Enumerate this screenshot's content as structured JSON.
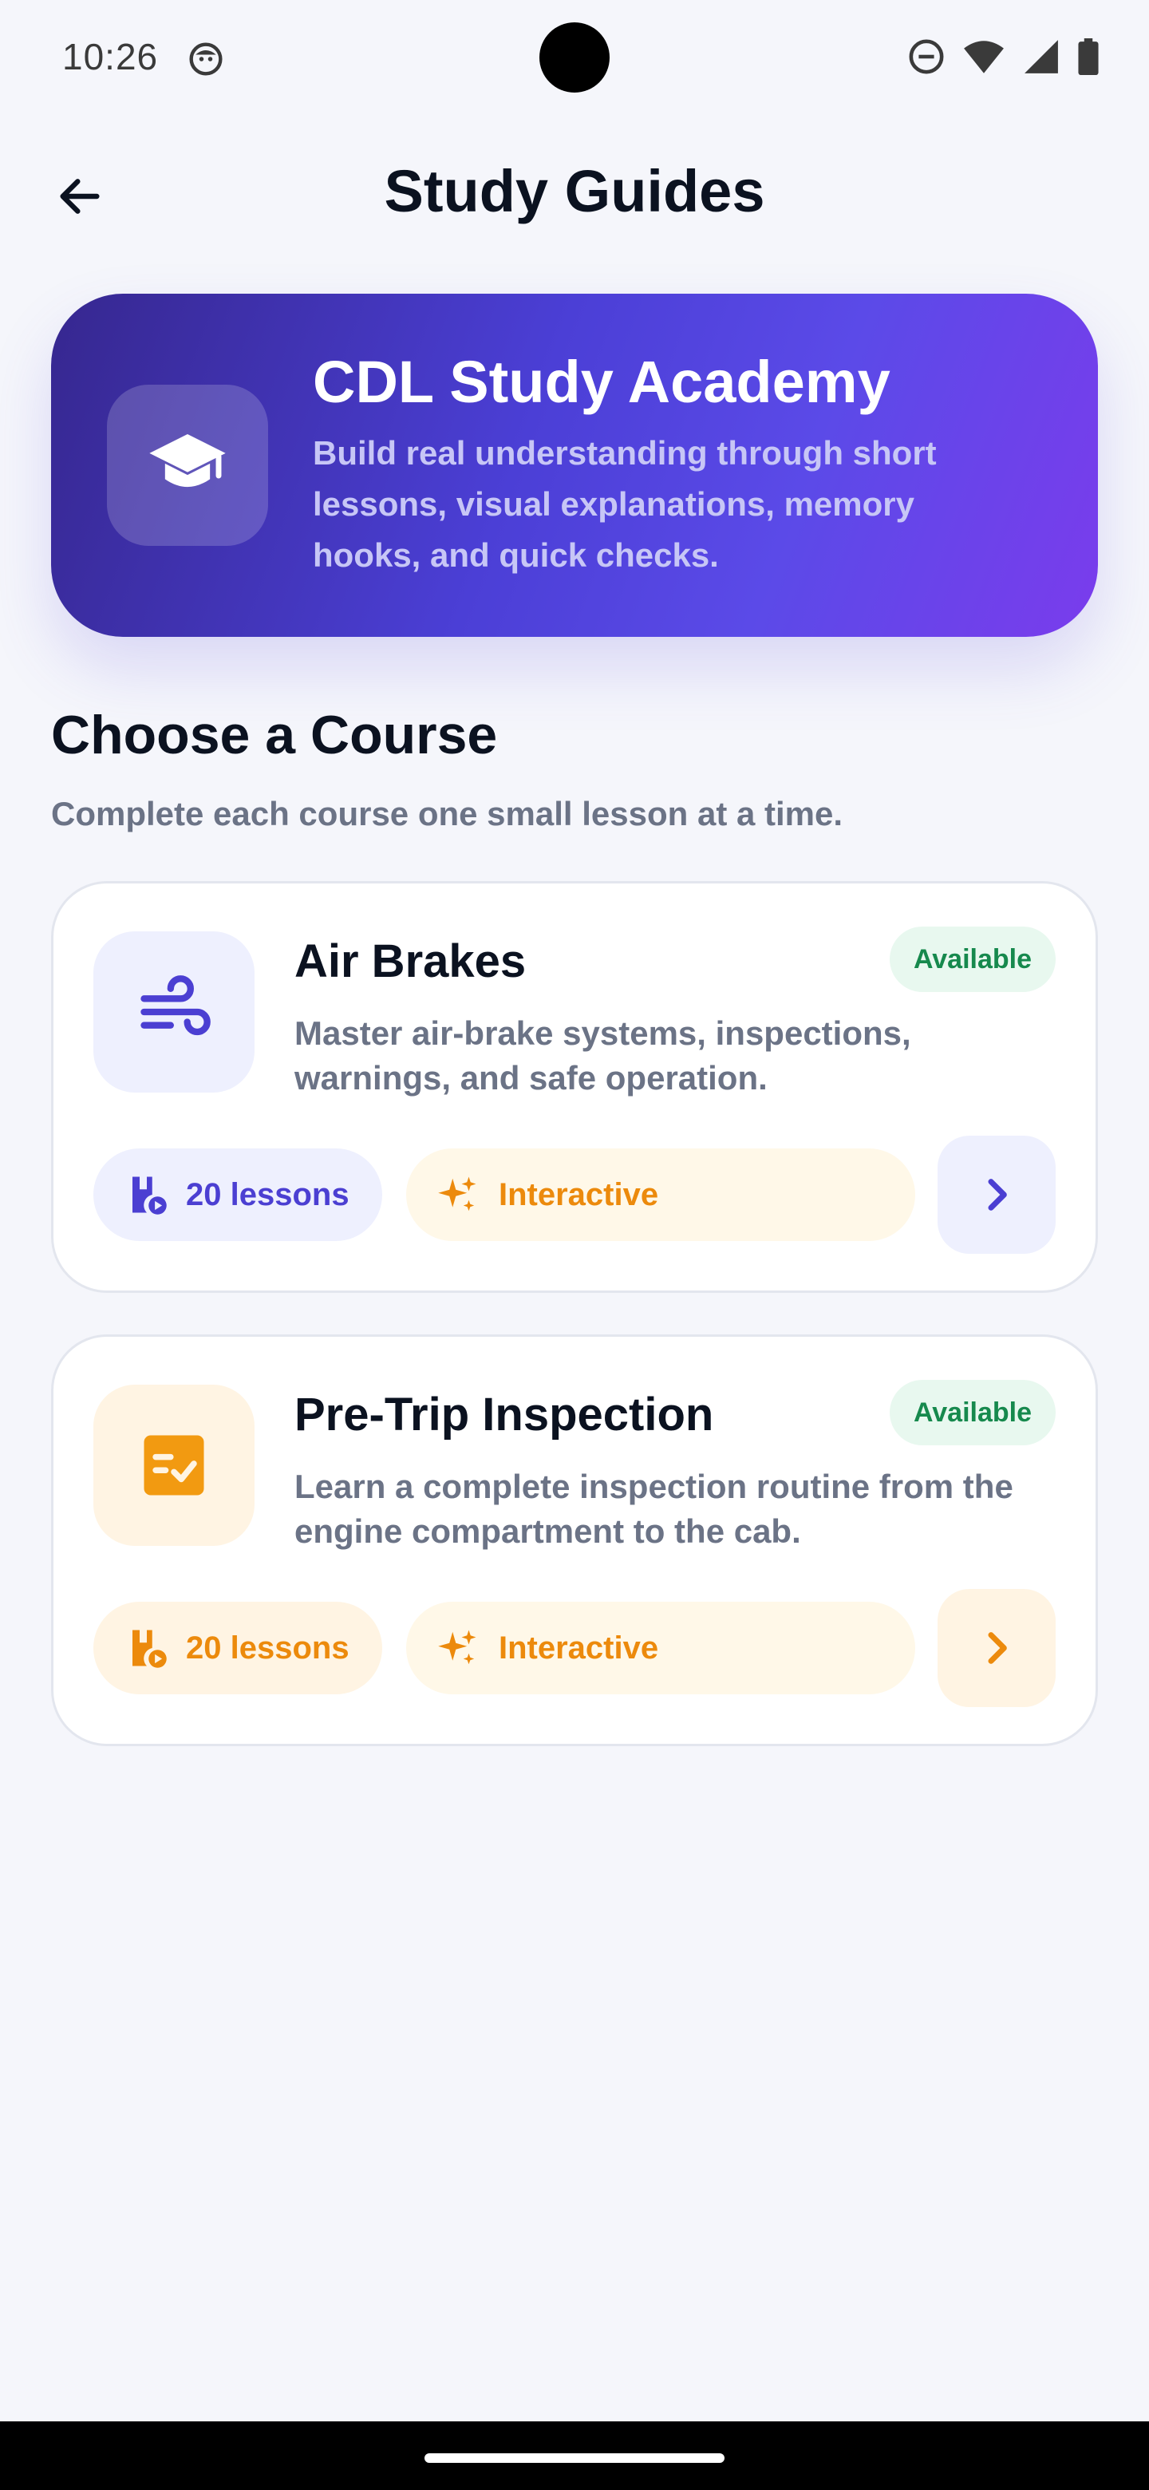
{
  "status_bar": {
    "time": "10:26"
  },
  "header": {
    "title": "Study Guides"
  },
  "hero": {
    "title": "CDL Study Academy",
    "description": "Build real understanding through short lessons, visual explanations, memory hooks, and quick checks.",
    "icon": "graduation-cap-icon"
  },
  "section": {
    "title": "Choose a Course",
    "subtitle": "Complete each course one small lesson at a time."
  },
  "courses": [
    {
      "title": "Air Brakes",
      "badge": "Available",
      "description": "Master air-brake systems, inspections, warnings, and safe operation.",
      "lessons": "20 lessons",
      "mode": "Interactive",
      "icon": "wind-icon",
      "accent": "#4b3fd2"
    },
    {
      "title": "Pre-Trip Inspection",
      "badge": "Available",
      "description": "Learn a complete inspection routine from the engine compartment to the cab.",
      "lessons": "20 lessons",
      "mode": "Interactive",
      "icon": "checklist-icon",
      "accent": "#f29a11"
    }
  ],
  "colors": {
    "background": "#f5f6fb",
    "hero_gradient_start": "#36278f",
    "hero_gradient_end": "#7a3cec",
    "available_green": "#16894d",
    "interactive_orange": "#ec8a0c"
  }
}
